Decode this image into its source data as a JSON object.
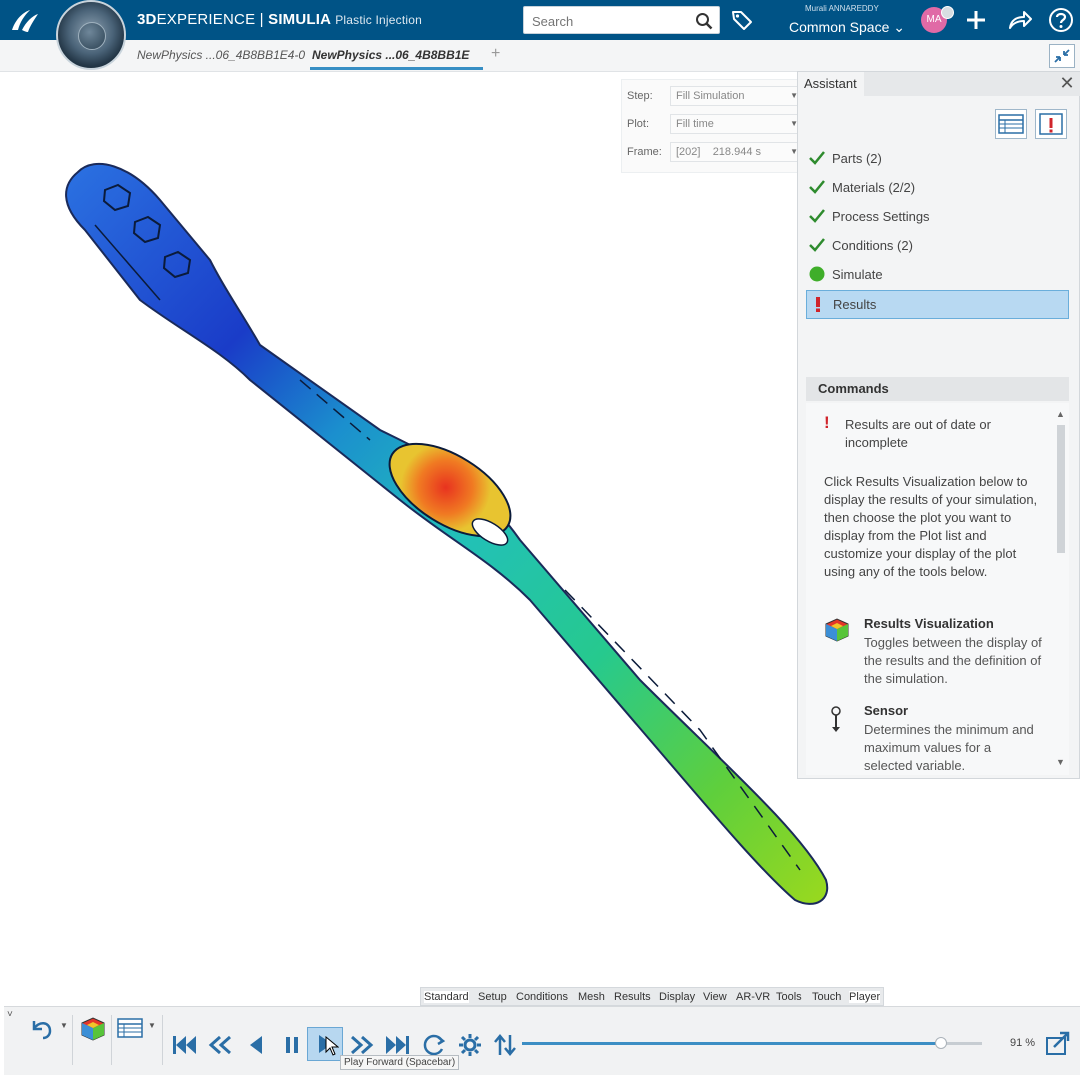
{
  "app": {
    "brand_bold": "3D",
    "brand_rest": "EXPERIENCE | ",
    "brand_product": "SIMULIA",
    "app_name": "Plastic Injection",
    "accent_color": "#005386"
  },
  "search": {
    "placeholder": "Search"
  },
  "user": {
    "name": "Murali ANNAREDDY",
    "space": "Common Space",
    "initials": "MA"
  },
  "tabs": [
    {
      "label": "NewPhysics ...06_4B8BB1E4-0",
      "active": false
    },
    {
      "label": "NewPhysics ...06_4B8BB1E",
      "active": true
    }
  ],
  "results_panel": {
    "step_label": "Step:",
    "step_value": "Fill Simulation",
    "plot_label": "Plot:",
    "plot_value": "Fill time",
    "frame_label": "Frame:",
    "frame_value": "[202]    218.944 s"
  },
  "assistant": {
    "title": "Assistant",
    "steps": [
      {
        "label": "Parts (2)",
        "status": "done"
      },
      {
        "label": "Materials (2/2)",
        "status": "done"
      },
      {
        "label": "Process Settings",
        "status": "done"
      },
      {
        "label": "Conditions (2)",
        "status": "done"
      },
      {
        "label": "Simulate",
        "status": "ready"
      },
      {
        "label": "Results",
        "status": "warning"
      }
    ],
    "commands_title": "Commands",
    "warning": "Results are out of date or incomplete",
    "description": "Click Results Visualization below to display the results of your simulation, then choose the plot you want to display from the Plot list and customize your display of the plot using any of the tools below.",
    "commands": [
      {
        "title": "Results Visualization",
        "desc": "Toggles between the display of the results and the definition of the simulation."
      },
      {
        "title": "Sensor",
        "desc": "Determines the minimum and maximum values for a selected variable."
      }
    ]
  },
  "section_tabs": [
    "Standard",
    "Setup",
    "Conditions",
    "Mesh",
    "Results",
    "Display",
    "View",
    "AR-VR",
    "Tools",
    "Touch",
    "Player"
  ],
  "player": {
    "zoom": "91 %",
    "progress": 0.91,
    "tooltip": "Play Forward (Spacebar)"
  }
}
